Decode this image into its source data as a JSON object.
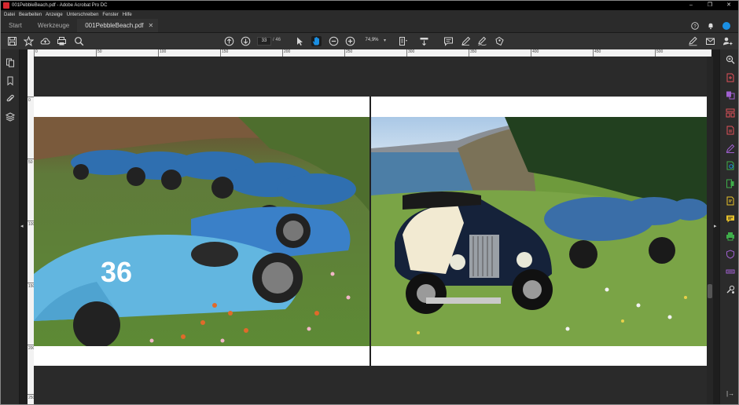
{
  "window": {
    "title": "001PebbleBeach.pdf - Adobe Acrobat Pro DC",
    "controls": {
      "minimize": "–",
      "maximize": "❐",
      "close": "✕"
    }
  },
  "menu": [
    "Datei",
    "Bearbeiten",
    "Anzeige",
    "Unterschreiben",
    "Fenster",
    "Hilfe"
  ],
  "tabs": [
    {
      "label": "Start",
      "active": false
    },
    {
      "label": "Werkzeuge",
      "active": false
    },
    {
      "label": "001PebbleBeach.pdf",
      "active": true,
      "close": "✕"
    }
  ],
  "toolbar": {
    "current_page": "33",
    "page_total": "/ 46",
    "zoom": "74,9%",
    "zoom_caret": "▾"
  },
  "ruler_top": {
    "labels": [
      "0",
      "50",
      "100",
      "150",
      "200",
      "250",
      "300",
      "350",
      "400",
      "450",
      "500"
    ]
  },
  "ruler_left": {
    "labels": [
      "0",
      "50",
      "100",
      "150",
      "200",
      "250"
    ]
  },
  "nav": {
    "left": "◂",
    "right": "▸",
    "collapse": "|→"
  },
  "icons": {
    "save": "save-icon",
    "bookmark_star": "star-icon",
    "upload": "cloud-upload-icon",
    "print": "print-icon",
    "zoom_search": "search-icon",
    "prev_page": "arrow-up-circle-icon",
    "next_page": "arrow-down-circle-icon",
    "select": "cursor-arrow-icon",
    "hand": "hand-icon",
    "zoom_out": "zoom-out-icon",
    "zoom_in": "zoom-in-icon",
    "page_fit": "page-fit-icon",
    "scroll_mode": "scroll-mode-icon",
    "comment": "comment-icon",
    "pen": "pen-icon",
    "sign": "sign-icon",
    "stamp": "stamp-icon",
    "help": "help-icon",
    "bell": "bell-icon",
    "account": "account-icon",
    "fill_sign": "fill-sign-icon",
    "mail": "mail-icon",
    "share_user": "share-user-icon"
  },
  "colors": {
    "accent_blue": "#1a8fe3",
    "pdf_red": "#d7282f",
    "tool_pink": "#e0505a",
    "tool_purple": "#a060d0",
    "tool_green": "#3fae4a",
    "tool_yellow": "#e8c22a"
  },
  "right_tools": [
    {
      "name": "zoom-tool-icon",
      "color": "#d6d6d6"
    },
    {
      "name": "create-pdf-icon",
      "color": "#e0505a"
    },
    {
      "name": "combine-files-icon",
      "color": "#a060d0"
    },
    {
      "name": "organize-pages-icon",
      "color": "#e0505a"
    },
    {
      "name": "export-pdf-icon",
      "color": "#e0505a"
    },
    {
      "name": "edit-pdf-icon",
      "color": "#a060d0"
    },
    {
      "name": "scan-ocr-icon",
      "color": "#3fae4a"
    },
    {
      "name": "rich-media-icon",
      "color": "#3fae4a"
    },
    {
      "name": "send-for-comments-icon",
      "color": "#e8c22a"
    },
    {
      "name": "comment-tool-icon",
      "color": "#e8c22a"
    },
    {
      "name": "print-production-icon",
      "color": "#3fae4a"
    },
    {
      "name": "protect-icon",
      "color": "#a060d0"
    },
    {
      "name": "redact-icon",
      "color": "#a060d0"
    },
    {
      "name": "more-tools-icon",
      "color": "#d6d6d6"
    }
  ]
}
